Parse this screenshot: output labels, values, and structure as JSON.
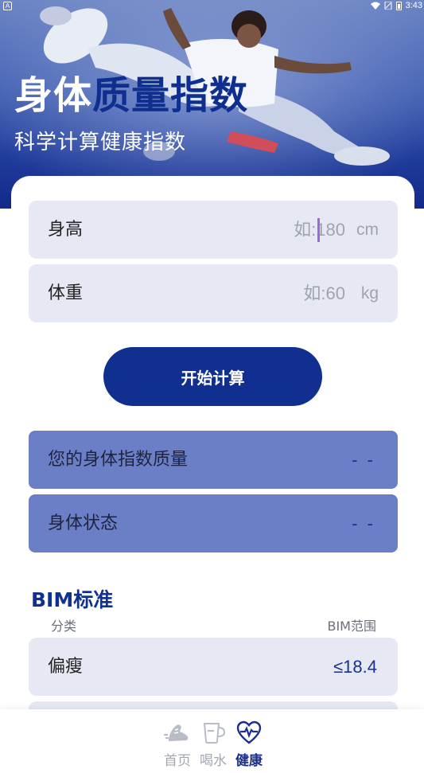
{
  "status_bar": {
    "left_icon": "A",
    "time": "3:43"
  },
  "hero": {
    "title_part1": "身体",
    "title_part2": "质量指数",
    "subtitle": "科学计算健康指数"
  },
  "form": {
    "height": {
      "label": "身高",
      "placeholder": "如:180",
      "value": "",
      "unit": "cm"
    },
    "weight": {
      "label": "体重",
      "placeholder": "如:60",
      "value": "",
      "unit": "kg"
    },
    "calculate_label": "开始计算"
  },
  "results": [
    {
      "label": "您的身体指数质量",
      "value": "- -"
    },
    {
      "label": "身体状态",
      "value": "- -"
    }
  ],
  "bim_standard": {
    "title": "BIM标准",
    "col_category": "分类",
    "col_range": "BIM范围",
    "rows": [
      {
        "category": "偏瘦",
        "range": "≤18.4"
      }
    ]
  },
  "nav": {
    "items": [
      {
        "label": "首页",
        "icon": "shoe-icon",
        "active": false
      },
      {
        "label": "喝水",
        "icon": "cup-icon",
        "active": false
      },
      {
        "label": "健康",
        "icon": "heart-pulse-icon",
        "active": true
      }
    ]
  },
  "colors": {
    "primary": "#112f8f",
    "result_bg": "#6b7fc6",
    "field_bg": "#e6e9f3",
    "nav_inactive": "#a3a7b2"
  }
}
